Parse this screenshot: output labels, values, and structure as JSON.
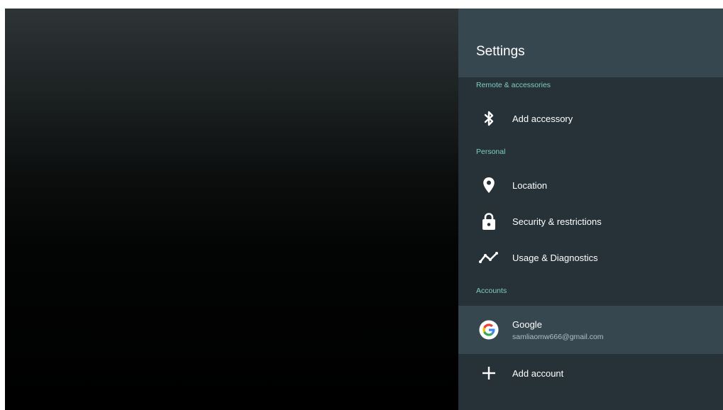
{
  "settings": {
    "title": "Settings",
    "sections": {
      "remote": {
        "label": "Remote & accessories",
        "items": [
          {
            "label": "Add accessory",
            "icon": "bluetooth-icon"
          }
        ]
      },
      "personal": {
        "label": "Personal",
        "items": [
          {
            "label": "Location",
            "icon": "location-pin-icon"
          },
          {
            "label": "Security & restrictions",
            "icon": "lock-icon"
          },
          {
            "label": "Usage & Diagnostics",
            "icon": "diagnostics-trend-icon"
          }
        ]
      },
      "accounts": {
        "label": "Accounts",
        "items": [
          {
            "label": "Google",
            "sub": "samliaomw666@gmail.com",
            "icon": "google-logo-icon"
          },
          {
            "label": "Add account",
            "icon": "plus-icon"
          }
        ]
      }
    }
  },
  "colors": {
    "panel": "#263238",
    "header": "#37474f",
    "focused_row": "#37474f",
    "section_label": "#80cbc4",
    "text": "#ffffff",
    "subtext": "#b0bec5"
  }
}
